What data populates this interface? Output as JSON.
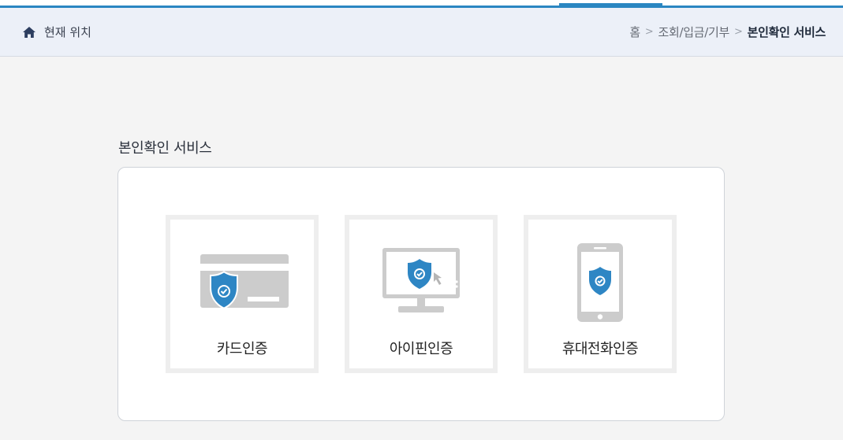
{
  "location": {
    "label": "현재 위치",
    "breadcrumb": {
      "home": "홈",
      "separator1": ">",
      "category": "조회/입금/기부",
      "separator2": ">",
      "current": "본인확인 서비스"
    }
  },
  "main": {
    "title": "본인확인 서비스",
    "options": [
      {
        "label": "카드인증",
        "icon": "card-shield-icon"
      },
      {
        "label": "아이핀인증",
        "icon": "monitor-shield-icon"
      },
      {
        "label": "휴대전화인증",
        "icon": "phone-shield-icon"
      }
    ]
  },
  "colors": {
    "accent": "#2a86c1",
    "shield": "#2e86c4",
    "device_gray": "#cccccc"
  }
}
